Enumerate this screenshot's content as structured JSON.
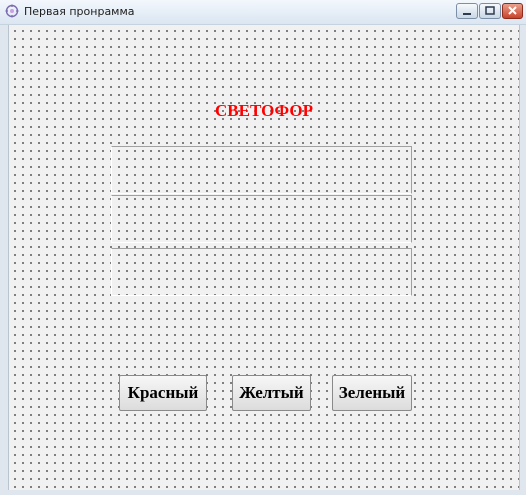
{
  "window": {
    "title": "Первая пронрамма"
  },
  "form": {
    "heading": "СВЕТОФОР",
    "heading_color": "#ff0000",
    "buttons": {
      "red": "Красный",
      "yellow": "Желтый",
      "green": "Зеленый"
    }
  },
  "icons": {
    "app": "app-icon",
    "minimize": "minimize-icon",
    "maximize": "maximize-icon",
    "close": "close-icon"
  },
  "colors": {
    "close_button": "#c7432b",
    "form_background": "#f1f1f1"
  }
}
